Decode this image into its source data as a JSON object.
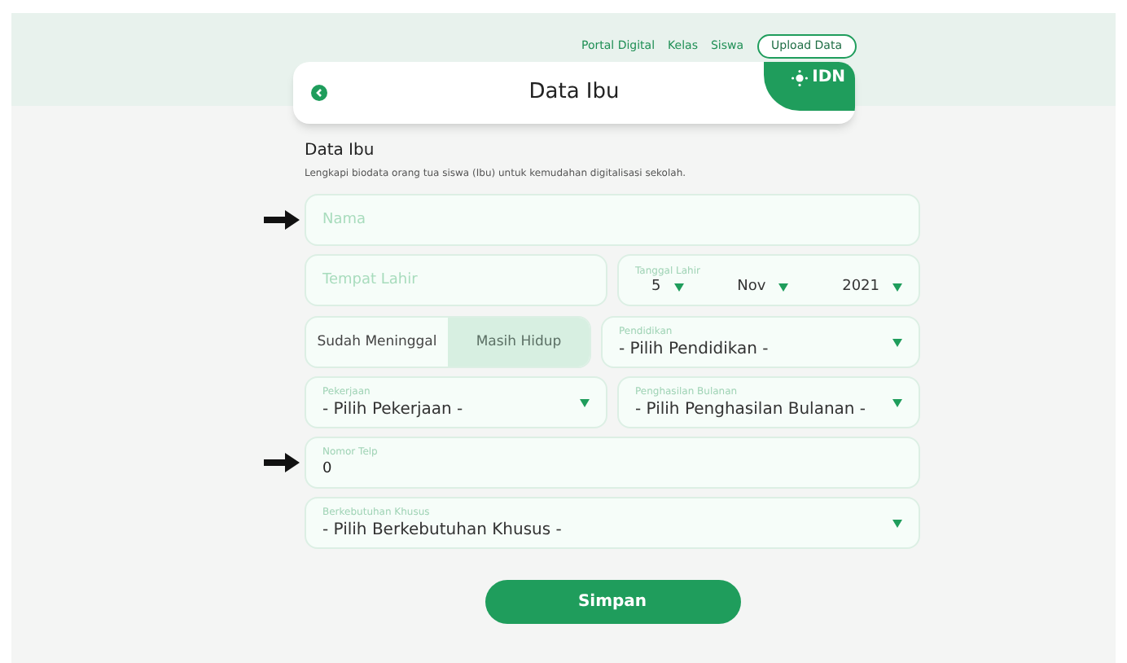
{
  "nav": {
    "links": [
      "Portal Digital",
      "Kelas",
      "Siswa"
    ],
    "upload_button": "Upload Data"
  },
  "header": {
    "title": "Data Ibu",
    "logo": "IDN"
  },
  "section": {
    "title": "Data Ibu",
    "description": "Lengkapi biodata orang tua siswa (Ibu) untuk kemudahan digitalisasi sekolah."
  },
  "nama": {
    "placeholder": "Nama",
    "arrow": true
  },
  "tempat_lahir": {
    "placeholder": "Tempat Lahir"
  },
  "tanggal_lahir": {
    "label": "Tanggal Lahir",
    "day": "5",
    "month": "Nov",
    "year": "2021"
  },
  "status": [
    {
      "label": "Sudah Meninggal",
      "selected": false
    },
    {
      "label": "Masih Hidup",
      "selected": true
    }
  ],
  "pendidikan": {
    "label": "Pendidikan",
    "value": "- Pilih Pendidikan -"
  },
  "pekerjaan": {
    "label": "Pekerjaan",
    "value": "- Pilih Pekerjaan -"
  },
  "penghasilan": {
    "label": "Penghasilan Bulanan",
    "value": "- Pilih Penghasilan Bulanan -"
  },
  "telp": {
    "label": "Nomor Telp",
    "value": "0",
    "arrow": true
  },
  "berkebutuhan": {
    "label": "Berkebutuhan Khusus",
    "value": "- Pilih Berkebutuhan Khusus -"
  },
  "submit": "Simpan"
}
